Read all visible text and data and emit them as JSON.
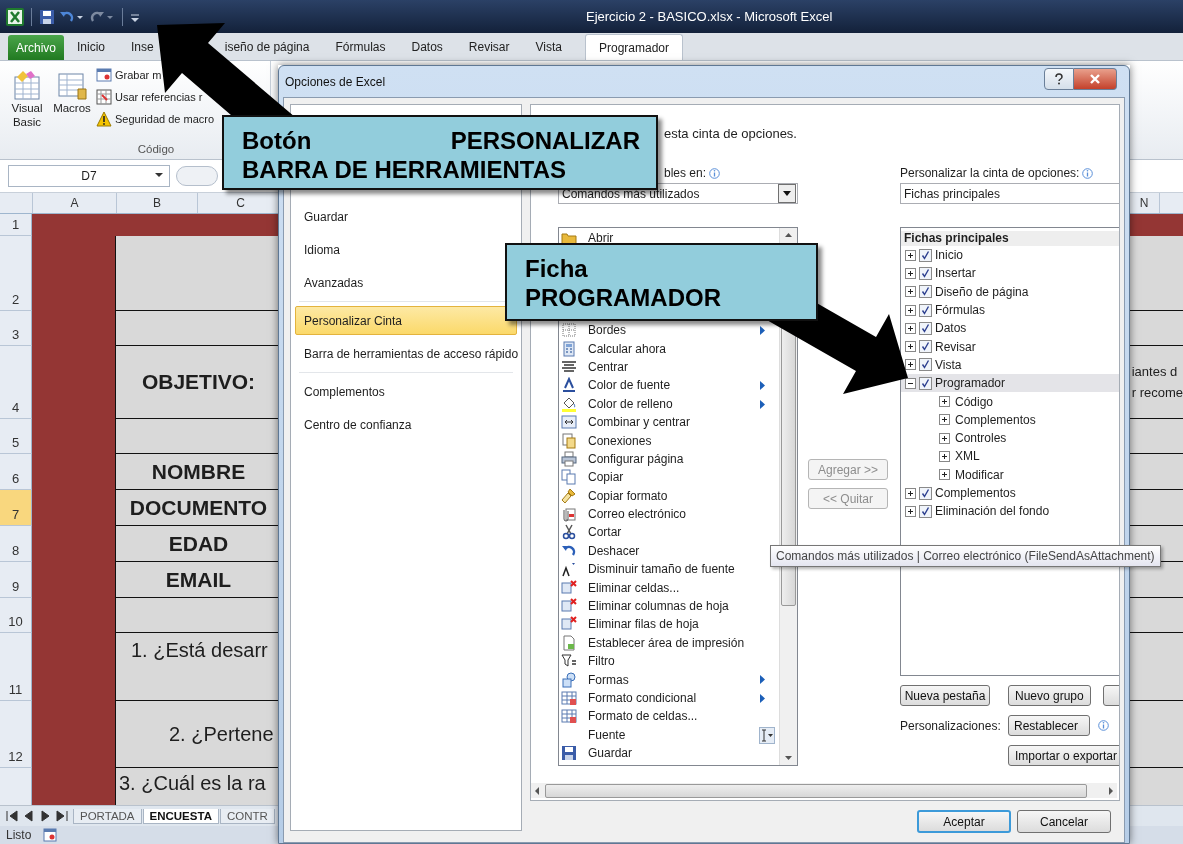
{
  "title_bar": {
    "title": "Ejercicio 2 - BASICO.xlsx - Microsoft Excel"
  },
  "ribbon_tabs": [
    {
      "label": "Archivo",
      "kind": "file",
      "selected": false
    },
    {
      "label": "Inicio",
      "kind": "tab",
      "selected": false
    },
    {
      "label": "Inse",
      "kind": "tab",
      "selected": false
    },
    {
      "label": "iseño de página",
      "kind": "tab",
      "selected": false
    },
    {
      "label": "Fórmulas",
      "kind": "tab",
      "selected": false
    },
    {
      "label": "Datos",
      "kind": "tab",
      "selected": false
    },
    {
      "label": "Revisar",
      "kind": "tab",
      "selected": false
    },
    {
      "label": "Vista",
      "kind": "tab",
      "selected": false
    },
    {
      "label": "Programador",
      "kind": "tab",
      "selected": true
    }
  ],
  "ribbon": {
    "large_buttons": [
      {
        "label": "Visual Basic"
      },
      {
        "label": "Macros"
      }
    ],
    "small_buttons": [
      {
        "label": "Grabar m"
      },
      {
        "label": "Usar referencias r"
      },
      {
        "label": "Seguridad de macro"
      }
    ],
    "group_label": "Código"
  },
  "formula_bar": {
    "name_box": "D7"
  },
  "sheet": {
    "columns": [
      "A",
      "B",
      "C",
      "N"
    ],
    "rows": [
      {
        "number": "1",
        "kind": "band",
        "selected": false
      },
      {
        "number": "2",
        "kind": "blank",
        "selected": false
      },
      {
        "number": "3",
        "kind": "blank",
        "selected": false
      },
      {
        "number": "4",
        "kind": "heading",
        "text": "OBJETIVO:",
        "right_lines": [
          "iantes d",
          "r recome"
        ],
        "selected": false
      },
      {
        "number": "5",
        "kind": "blank",
        "selected": false
      },
      {
        "number": "6",
        "kind": "heading",
        "text": "NOMBRE",
        "selected": false
      },
      {
        "number": "7",
        "kind": "heading",
        "text": "DOCUMENTO",
        "selected": true
      },
      {
        "number": "8",
        "kind": "heading",
        "text": "EDAD",
        "selected": false
      },
      {
        "number": "9",
        "kind": "heading",
        "text": "EMAIL",
        "selected": false
      },
      {
        "number": "10",
        "kind": "blank",
        "selected": false
      },
      {
        "number": "11",
        "kind": "question",
        "text": "1. ¿Está desarr",
        "selected": false
      },
      {
        "number": "12",
        "kind": "question",
        "text": "2. ¿Pertene",
        "selected": false
      },
      {
        "kind": "question",
        "text": "3. ¿Cuál es la ra",
        "selected": false
      }
    ]
  },
  "sheet_tabs": [
    {
      "label": "PORTADA",
      "selected": false
    },
    {
      "label": "ENCUESTA",
      "selected": true
    },
    {
      "label": "CONTR",
      "selected": false
    }
  ],
  "status_bar": {
    "text": "Listo"
  },
  "dialog": {
    "title": "Opciones de Excel",
    "nav": [
      {
        "label": "Guardar",
        "selected": false,
        "separator_after": false
      },
      {
        "label": "Idioma",
        "selected": false,
        "separator_after": false
      },
      {
        "label": "Avanzadas",
        "selected": false,
        "separator_after": true
      },
      {
        "label": "Personalizar Cinta",
        "selected": true,
        "separator_after": false
      },
      {
        "label": "Barra de herramientas de acceso rápido",
        "selected": false,
        "separator_after": true
      },
      {
        "label": "Complementos",
        "selected": false,
        "separator_after": false
      },
      {
        "label": "Centro de confianza",
        "selected": false,
        "separator_after": false
      }
    ],
    "heading": "esta cinta de opciones.",
    "commands_label": "bles en:",
    "commands_dropdown": "Comandos más utilizados",
    "commands": [
      {
        "label": "Abrir",
        "submenu": false,
        "kind": "plain"
      },
      {
        "label": "Bordes",
        "submenu": true,
        "kind": "plain"
      },
      {
        "label": "Calcular ahora",
        "submenu": false,
        "kind": "plain"
      },
      {
        "label": "Centrar",
        "submenu": false,
        "kind": "plain"
      },
      {
        "label": "Color de fuente",
        "submenu": true,
        "kind": "plain"
      },
      {
        "label": "Color de relleno",
        "submenu": true,
        "kind": "plain"
      },
      {
        "label": "Combinar y centrar",
        "submenu": false,
        "kind": "plain"
      },
      {
        "label": "Conexiones",
        "submenu": false,
        "kind": "plain"
      },
      {
        "label": "Configurar página",
        "submenu": false,
        "kind": "plain"
      },
      {
        "label": "Copiar",
        "submenu": false,
        "kind": "plain"
      },
      {
        "label": "Copiar formato",
        "submenu": false,
        "kind": "plain"
      },
      {
        "label": "Correo electrónico",
        "submenu": false,
        "kind": "plain"
      },
      {
        "label": "Cortar",
        "submenu": false,
        "kind": "plain"
      },
      {
        "label": "Deshacer",
        "submenu": false,
        "kind": "plain"
      },
      {
        "label": "Disminuir tamaño de fuente",
        "submenu": false,
        "kind": "plain"
      },
      {
        "label": "Eliminar celdas...",
        "submenu": false,
        "kind": "plain"
      },
      {
        "label": "Eliminar columnas de hoja",
        "submenu": false,
        "kind": "plain"
      },
      {
        "label": "Eliminar filas de hoja",
        "submenu": false,
        "kind": "plain"
      },
      {
        "label": "Establecer área de impresión",
        "submenu": false,
        "kind": "plain"
      },
      {
        "label": "Filtro",
        "submenu": false,
        "kind": "plain"
      },
      {
        "label": "Formas",
        "submenu": true,
        "kind": "plain"
      },
      {
        "label": "Formato condicional",
        "submenu": true,
        "kind": "plain"
      },
      {
        "label": "Formato de celdas...",
        "submenu": false,
        "kind": "plain"
      },
      {
        "label": "Fuente",
        "submenu": false,
        "kind": "font_picker"
      },
      {
        "label": "Guardar",
        "submenu": false,
        "kind": "plain"
      }
    ],
    "add_button": {
      "label": "Agregar >>",
      "disabled": true
    },
    "remove_button": {
      "label": "<< Quitar",
      "disabled": true
    },
    "ribbon_label": "Personalizar la cinta de opciones:",
    "ribbon_dropdown": "Fichas principales",
    "tree": {
      "header": "Fichas principales",
      "items": [
        {
          "label": "Inicio",
          "checked": true,
          "expanded": false,
          "selected": false
        },
        {
          "label": "Insertar",
          "checked": true,
          "expanded": false,
          "selected": false
        },
        {
          "label": "Diseño de página",
          "checked": true,
          "expanded": false,
          "selected": false
        },
        {
          "label": "Fórmulas",
          "checked": true,
          "expanded": false,
          "selected": false
        },
        {
          "label": "Datos",
          "checked": true,
          "expanded": false,
          "selected": false
        },
        {
          "label": "Revisar",
          "checked": true,
          "expanded": false,
          "selected": false
        },
        {
          "label": "Vista",
          "checked": true,
          "expanded": false,
          "selected": false
        },
        {
          "label": "Programador",
          "checked": true,
          "expanded": true,
          "selected": true,
          "children": [
            {
              "label": "Código",
              "expanded": false
            },
            {
              "label": "Complementos",
              "expanded": false
            },
            {
              "label": "Controles",
              "expanded": false
            },
            {
              "label": "XML",
              "expanded": false
            },
            {
              "label": "Modificar",
              "expanded": false
            }
          ]
        },
        {
          "label": "Complementos",
          "checked": true,
          "expanded": false,
          "selected": false
        },
        {
          "label": "Eliminación del fondo",
          "checked": true,
          "expanded": false,
          "selected": false
        }
      ]
    },
    "tree_buttons": [
      "Nueva pestaña",
      "Nuevo grupo"
    ],
    "customizations_label": "Personalizaciones:",
    "reset_button": "Restablecer",
    "import_button": "Importar o exportar",
    "footer_buttons": [
      {
        "label": "Aceptar",
        "default": true
      },
      {
        "label": "Cancelar",
        "default": false
      }
    ],
    "tooltip": "Comandos más utilizados | Correo electrónico (FileSendAsAttachment)"
  },
  "callouts": [
    {
      "lines": [
        [
          "Botón",
          "PERSONALIZAR"
        ],
        [
          "BARRA DE HERRAMIENTAS"
        ]
      ]
    },
    {
      "lines": [
        [
          "Ficha"
        ],
        [
          "PROGRAMADOR"
        ]
      ]
    }
  ]
}
